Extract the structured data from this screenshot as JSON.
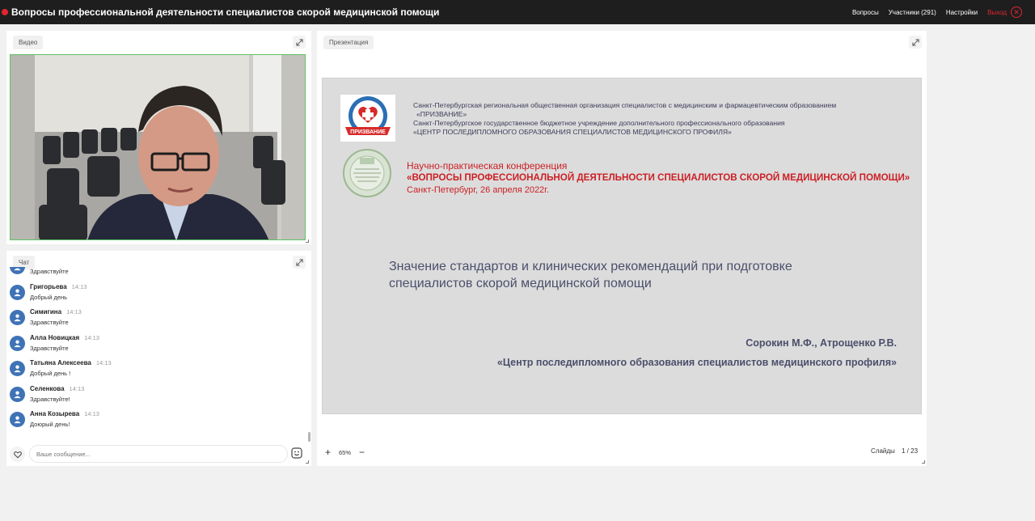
{
  "header": {
    "title": "Вопросы профессиональной деятельности специалистов скорой медицинской помощи",
    "nav": {
      "questions": "Вопросы",
      "participants": "Участники (291)",
      "settings": "Настройки",
      "exit": "Выход"
    }
  },
  "video": {
    "tab_label": "Видео"
  },
  "chat": {
    "tab_label": "Чат",
    "messages": [
      {
        "name": "",
        "time": "",
        "text": "Здравствуйте"
      },
      {
        "name": "Григорьева",
        "time": "14:13",
        "text": "Добрый день"
      },
      {
        "name": "Симигина",
        "time": "14:13",
        "text": "Здравствуйте"
      },
      {
        "name": "Алла Новицкая",
        "time": "14:13",
        "text": "Здравствуйте"
      },
      {
        "name": "Татьяна Алексеева",
        "time": "14:13",
        "text": "Добрый день !"
      },
      {
        "name": "Селенкова",
        "time": "14:13",
        "text": "Здравствуйте!"
      },
      {
        "name": "Анна Козырева",
        "time": "14:13",
        "text": "Доюрый день!"
      }
    ],
    "input_placeholder": "Ваше сообщение..."
  },
  "presentation": {
    "tab_label": "Презентация",
    "slide": {
      "org1_line1": "Санкт-Петербургская региональная общественная организация специалистов с медицинским и фармацевтическим образованием",
      "org1_line2": "«ПРИЗВАНИЕ»",
      "org2_line1": "Санкт-Петербургское государственное бюджетное учреждение дополнительного профессионального образования",
      "org2_line2": "«ЦЕНТР ПОСЛЕДИПЛОМНОГО ОБРАЗОВАНИЯ СПЕЦИАЛИСТОВ МЕДИЦИНСКОГО ПРОФИЛЯ»",
      "conference_type": "Научно-практическая конференция",
      "conference_name": "«ВОПРОСЫ ПРОФЕССИОНАЛЬНОЙ ДЕЯТЕЛЬНОСТИ СПЕЦИАЛИСТОВ СКОРОЙ МЕДИЦИНСКОЙ ПОМОЩИ»",
      "conference_place": "Санкт-Петербург, 26 апреля 2022г.",
      "talk_line1": "Значение стандартов и клинических рекомендаций при подготовке",
      "talk_line2": "специалистов скорой медицинской помощи",
      "authors": "Сорокин М.Ф., Атрощенко Р.В.",
      "center": "«Центр последипломного образования специалистов медицинского профиля»",
      "logo_text": "ПРИЗВАНИЕ"
    },
    "zoom_in": "+",
    "zoom_value": "65%",
    "zoom_out": "−",
    "slides_label": "Слайды",
    "slides_count": "1 / 23"
  },
  "colors": {
    "accent_red": "#e0262d",
    "avatar_blue": "#3f73b6",
    "video_border": "#5cc463"
  }
}
